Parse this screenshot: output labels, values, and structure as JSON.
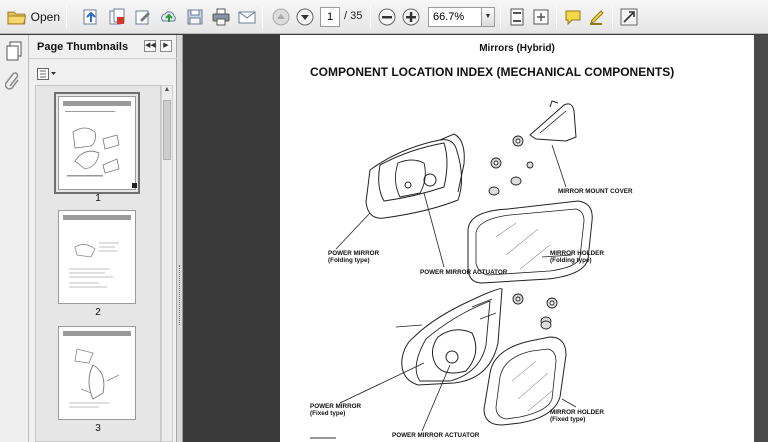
{
  "toolbar": {
    "open_label": "Open",
    "current_page": "1",
    "page_total": "/ 35",
    "zoom_level": "66.7%",
    "icons": [
      "folder-open-icon",
      "create-pdf-icon",
      "combine-icon",
      "sign-icon",
      "upload-icon",
      "save-icon",
      "print-icon",
      "email-icon",
      "prev-page-icon",
      "next-page-icon",
      "zoom-out-icon",
      "zoom-in-icon",
      "fit-width-icon",
      "fit-page-icon",
      "comment-icon",
      "highlight-icon",
      "expand-icon"
    ]
  },
  "sidebar": {
    "title": "Page Thumbnails",
    "thumbnails": [
      {
        "page": "1"
      },
      {
        "page": "2"
      },
      {
        "page": "3"
      }
    ]
  },
  "document": {
    "header": "Mirrors (Hybrid)",
    "title": "COMPONENT LOCATION INDEX (MECHANICAL COMPONENTS)",
    "labels": {
      "mount_cover": "MIRROR MOUNT COVER",
      "power_mirror_folding_1": "POWER MIRROR",
      "power_mirror_folding_2": "(Folding type)",
      "holder_folding_1": "MIRROR HOLDER",
      "holder_folding_2": "(Folding type)",
      "actuator_1": "POWER MIRROR ACTUATOR",
      "power_mirror_fixed_1": "POWER MIRROR",
      "power_mirror_fixed_2": "(Fixed type)",
      "holder_fixed_1": "MIRROR HOLDER",
      "holder_fixed_2": "(Fixed type)",
      "actuator_2": "POWER MIRROR ACTUATOR"
    }
  },
  "colors": {
    "toolbar_bg": "#ececec",
    "doc_bg": "#3a3a3a",
    "page_bg": "#ffffff"
  }
}
